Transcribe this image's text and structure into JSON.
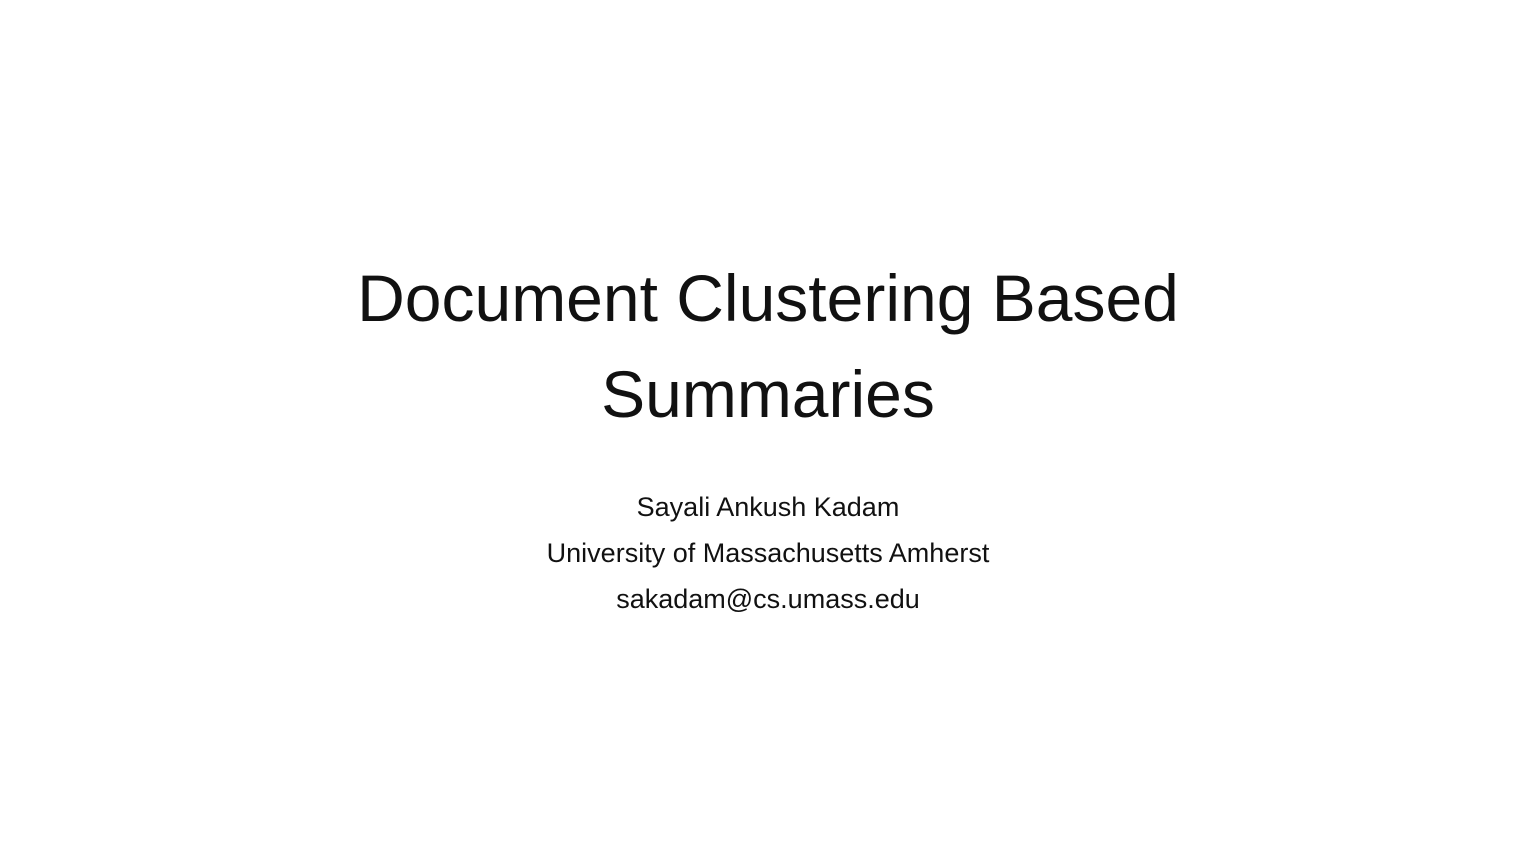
{
  "slide": {
    "title_lines": [
      "Document Clustering Based",
      "Summaries"
    ],
    "author": "Sayali Ankush Kadam",
    "affiliation": "University of Massachusetts Amherst",
    "email": "sakadam@cs.umass.edu"
  },
  "colors": {
    "background": "#ffffff",
    "text": "#111111"
  }
}
